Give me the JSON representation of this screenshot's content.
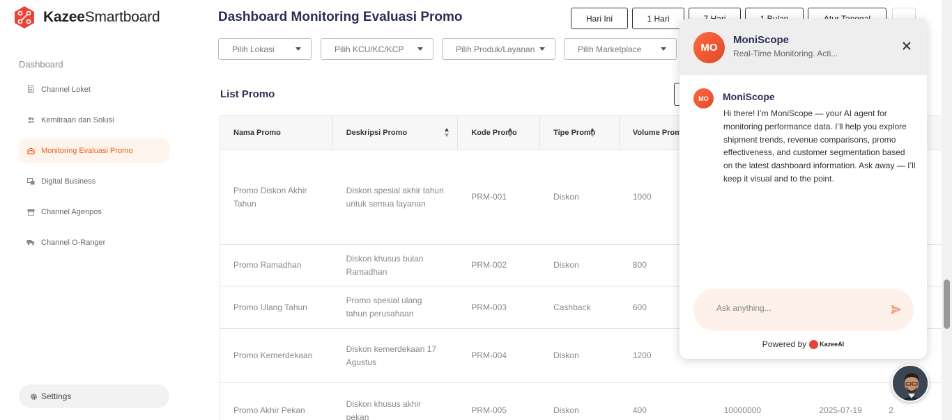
{
  "app": {
    "brand_bold": "Kazee",
    "brand_rest": "Smartboard"
  },
  "sidebar": {
    "section_label": "Dashboard",
    "items": [
      {
        "label": "Channel Loket",
        "icon": "building-icon"
      },
      {
        "label": "Kemitraan dan Solusi",
        "icon": "users-icon"
      },
      {
        "label": "Monitoring Evaluasi Promo",
        "icon": "promo-icon",
        "active": true
      },
      {
        "label": "Digital Business",
        "icon": "digital-icon"
      },
      {
        "label": "Channel Agenpos",
        "icon": "store-icon"
      },
      {
        "label": "Channel O-Ranger",
        "icon": "truck-icon"
      }
    ],
    "settings_label": "Settings"
  },
  "header": {
    "title": "Dashboard Monitoring Evaluasi Promo",
    "range_buttons": [
      "Hari Ini",
      "1 Hari",
      "7 Hari",
      "1 Bulan",
      "Atur Tanggal"
    ]
  },
  "filters": [
    "Pilih Lokasi",
    "Pilih KCU/KC/KCP",
    "Pilih Produk/Layanan",
    "Pilih Marketplace"
  ],
  "list": {
    "title": "List Promo",
    "columns": [
      "Nama Promo",
      "Deskripsi Promo",
      "Kode Promo",
      "Tipe Promo",
      "Volume Promo"
    ],
    "rows": [
      {
        "nama": "Promo Diskon Akhir Tahun",
        "deskripsi": "Diskon spesial akhir tahun untuk semua layanan",
        "kode": "PRM-001",
        "tipe": "Diskon",
        "volume": "1000",
        "nilai": "",
        "tanggal": "",
        "extra": ""
      },
      {
        "nama": "Promo Ramadhan",
        "deskripsi": "Diskon khusus bulan Ramadhan",
        "kode": "PRM-002",
        "tipe": "Diskon",
        "volume": "800",
        "nilai": "",
        "tanggal": "",
        "extra": ""
      },
      {
        "nama": "Promo Ulang Tahun",
        "deskripsi": "Promo spesial ulang tahun perusahaan",
        "kode": "PRM-003",
        "tipe": "Cashback",
        "volume": "600",
        "nilai": "",
        "tanggal": "",
        "extra": ""
      },
      {
        "nama": "Promo Kemerdekaan",
        "deskripsi": "Diskon kemerdekaan 17 Agustus",
        "kode": "PRM-004",
        "tipe": "Diskon",
        "volume": "1200",
        "nilai": "",
        "tanggal": "",
        "extra": ""
      },
      {
        "nama": "Promo Akhir Pekan",
        "deskripsi": "Diskon khusus akhir pekan",
        "kode": "PRM-005",
        "tipe": "Diskon",
        "volume": "400",
        "nilai": "10000000",
        "tanggal": "2025-07-19",
        "extra": "2"
      }
    ]
  },
  "chat": {
    "avatar_initials": "MO",
    "name": "MoniScope",
    "subtitle": "Real-Time Monitoring. Acti...",
    "message_sender": "MoniScope",
    "message": "Hi there! I’m MoniScope — your AI agent for monitoring performance data. I’ll help you explore shipment trends, revenue comparisons, promo effectiveness, and customer segmentation based on the latest dashboard information. Ask away — I’ll keep it visual and to the point.",
    "input_placeholder": "Ask anything...",
    "powered_by": "Powered by",
    "powered_brand": "KazeeAI"
  },
  "colors": {
    "accent": "#e8621f",
    "title": "#2b2f55",
    "active_bg": "#fff4ec",
    "chat_input_bg": "#fdf1ea"
  }
}
